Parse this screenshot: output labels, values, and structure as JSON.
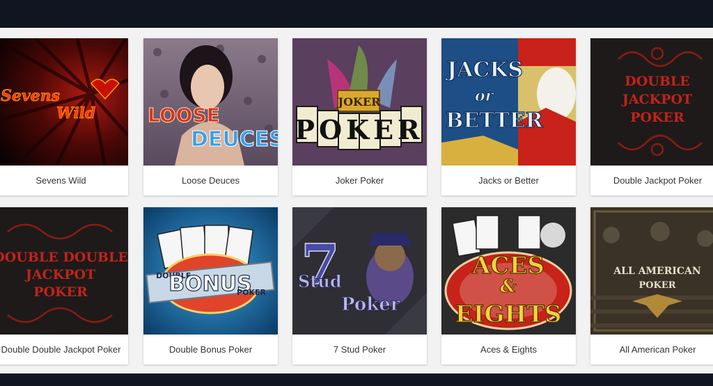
{
  "games": [
    {
      "title": "Sevens Wild",
      "art": [
        "Sevens",
        "Wild"
      ]
    },
    {
      "title": "Loose Deuces",
      "art": [
        "LOOSE",
        "DEUCES"
      ]
    },
    {
      "title": "Joker Poker",
      "art": [
        "JOKER",
        "POKER"
      ]
    },
    {
      "title": "Jacks or Better",
      "art": [
        "JACKS",
        "or",
        "BETTER"
      ]
    },
    {
      "title": "Double Jackpot Poker",
      "art": [
        "DOUBLE",
        "JACKPOT",
        "POKER"
      ]
    },
    {
      "title": "Double Double Jackpot Poker",
      "art": [
        "DOUBLE DOUBLE",
        "JACKPOT",
        "POKER"
      ]
    },
    {
      "title": "Double Bonus Poker",
      "art": [
        "DOUBLE",
        "BONUS",
        "POKER"
      ]
    },
    {
      "title": "7 Stud Poker",
      "art": [
        "7",
        "Stud",
        "Poker"
      ]
    },
    {
      "title": "Aces & Eights",
      "art": [
        "ACES",
        "&",
        "EIGHTS"
      ]
    },
    {
      "title": "All American Poker",
      "art": [
        "ALL AMERICAN",
        "POKER"
      ]
    }
  ],
  "colors": {
    "page_bg": "#101521",
    "grid_bg": "#f2f2f2",
    "tile_bg": "#ffffff",
    "caption_text": "#333333"
  }
}
